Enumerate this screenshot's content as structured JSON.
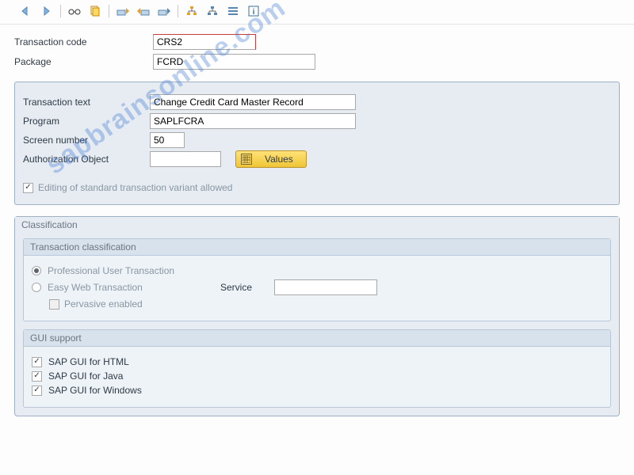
{
  "watermark": "sapbrainsonline.com",
  "header": {
    "tcode_label": "Transaction code",
    "tcode_value": "CRS2",
    "package_label": "Package",
    "package_value": "FCRD"
  },
  "details": {
    "text_label": "Transaction text",
    "text_value": "Change Credit Card Master Record",
    "program_label": "Program",
    "program_value": "SAPLFCRA",
    "screen_label": "Screen number",
    "screen_value": "50",
    "auth_label": "Authorization Object",
    "auth_value": "",
    "values_button": "Values",
    "edit_variant_label": "Editing of standard transaction variant allowed"
  },
  "classification": {
    "panel_title": "Classification",
    "trans_group_title": "Transaction classification",
    "opt_professional": "Professional User Transaction",
    "opt_easy_web": "Easy Web Transaction",
    "service_label": "Service",
    "service_value": "",
    "pervasive_label": "Pervasive enabled",
    "gui_group_title": "GUI support",
    "gui_html": "SAP GUI for HTML",
    "gui_java": "SAP GUI for Java",
    "gui_windows": "SAP GUI for Windows"
  },
  "toolbar_icons": [
    "back-icon",
    "forward-icon",
    "sep",
    "glasses-icon",
    "copy-icon",
    "sep",
    "transport-in-icon",
    "transport-out-icon",
    "transport-icon",
    "sep",
    "hierarchy-icon",
    "hierarchy2-icon",
    "list-icon",
    "info-icon"
  ]
}
